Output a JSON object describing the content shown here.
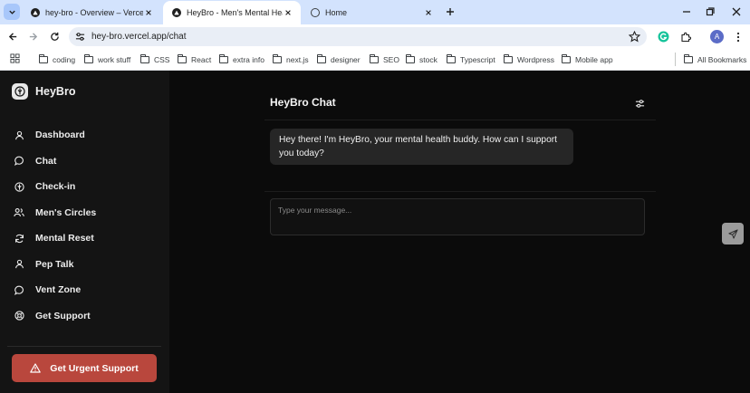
{
  "browser": {
    "tabs": [
      {
        "title": "hey-bro - Overview – Vercel",
        "active": false
      },
      {
        "title": "HeyBro - Men's Mental Health",
        "active": true
      },
      {
        "title": "Home",
        "active": false
      }
    ],
    "url": "hey-bro.vercel.app/chat",
    "profile_initial": "A",
    "bookmarks": [
      "coding",
      "work stuff",
      "CSS",
      "React",
      "extra info",
      "next.js",
      "designer",
      "SEO",
      "stock",
      "Typescript",
      "Wordpress",
      "Mobile app"
    ],
    "all_bookmarks": "All Bookmarks"
  },
  "app": {
    "brand": "HeyBro",
    "nav": [
      {
        "label": "Dashboard",
        "icon": "user-icon"
      },
      {
        "label": "Chat",
        "icon": "chat-bubble-icon"
      },
      {
        "label": "Check-in",
        "icon": "check-in-icon"
      },
      {
        "label": "Men's Circles",
        "icon": "users-icon"
      },
      {
        "label": "Mental Reset",
        "icon": "refresh-icon"
      },
      {
        "label": "Pep Talk",
        "icon": "user-icon"
      },
      {
        "label": "Vent Zone",
        "icon": "chat-bubble-icon"
      },
      {
        "label": "Get Support",
        "icon": "lifebuoy-icon"
      }
    ],
    "urgent_label": "Get Urgent Support",
    "colors": {
      "urgent": "#b9473d",
      "sidebar": "#141414",
      "main": "#0b0b0b"
    }
  },
  "chat": {
    "title": "HeyBro Chat",
    "messages": [
      {
        "from": "bot",
        "text": "Hey there! I'm HeyBro, your mental health buddy. How can I support you today?"
      }
    ],
    "input_placeholder": "Type your message..."
  }
}
